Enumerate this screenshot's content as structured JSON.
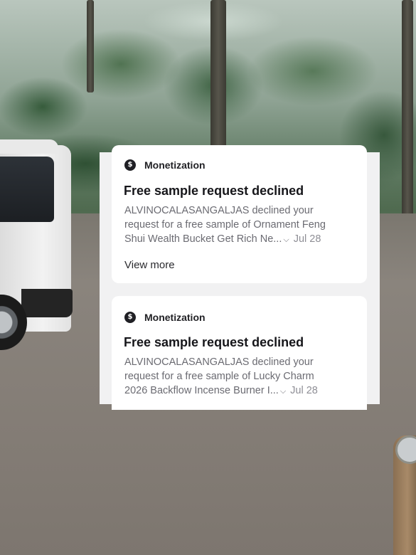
{
  "notifications": [
    {
      "category": "Monetization",
      "category_icon": "coin-icon",
      "icon_glyph": "$",
      "title": "Free sample request declined",
      "body_line1": "ALVINOCALASANGALJAS declined your",
      "body_line2": "request for a free sample of Ornament Feng",
      "body_line3": "Shui Wealth Bucket Get Rich Ne...",
      "date": "Jul 28",
      "view_more": "View more"
    },
    {
      "category": "Monetization",
      "category_icon": "coin-icon",
      "icon_glyph": "$",
      "title": "Free sample request declined",
      "body_line1": "ALVINOCALASANGALJAS declined your",
      "body_line2": "request for a free sample of Lucky Charm",
      "body_line3": "2026  Backflow Incense Burner I...",
      "date": "Jul 28"
    }
  ],
  "colors": {
    "panel_bg": "#f1f1f2",
    "card_bg": "#ffffff",
    "title_text": "#16161a",
    "body_text": "#6b6b72"
  }
}
